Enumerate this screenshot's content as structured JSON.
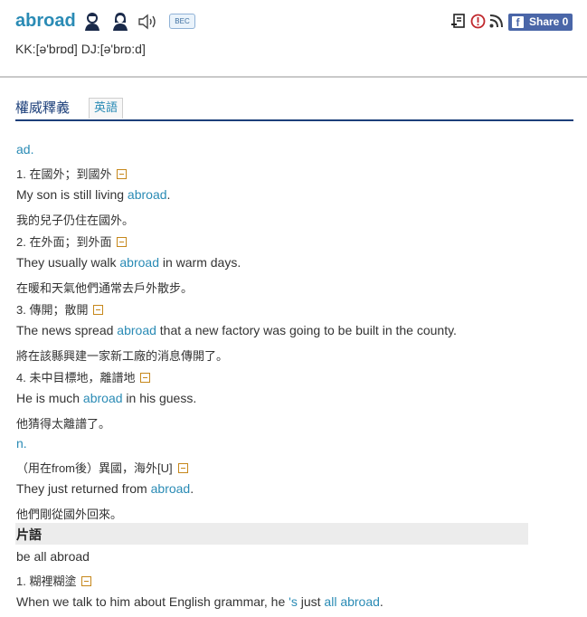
{
  "header": {
    "word": "abroad",
    "pronunciation": "KK:[ə'brɒd] DJ:[ə'brɒ:d]",
    "badge": "BEC",
    "share_label": "Share 0",
    "facebook_letter": "f"
  },
  "tabs": {
    "main": "權威釋義",
    "english": "英語"
  },
  "entries": {
    "l0": "ad.",
    "l1": "1. 在國外；到國外",
    "l2a": "My son is still living ",
    "l2b": "abroad",
    "l2c": ".",
    "l3": "我的兒子仍住在國外。",
    "l4": "2. 在外面；到外面",
    "l5a": "They usually walk ",
    "l5b": "abroad",
    "l5c": " in warm days.",
    "l6": "在暖和天氣他們通常去戶外散步。",
    "l7": "3. 傳開；散開",
    "l8a": "The news spread ",
    "l8b": "abroad",
    "l8c": " that a new factory was going to be built in the county.",
    "l9": "將在該縣興建一家新工廠的消息傳開了。",
    "l10": "4. 未中目標地，離譜地",
    "l11a": "He is much ",
    "l11b": "abroad",
    "l11c": " in his guess.",
    "l12": "他猜得太離譜了。",
    "l13": "n.",
    "l14": "（用在from後）異國，海外[U]",
    "l15a": "They just returned from ",
    "l15b": "abroad",
    "l15c": ".",
    "l16": "他們剛從國外回來。",
    "phrase_title": "片語",
    "l17": "be all abroad",
    "l18": "1. 糊裡糊塗",
    "l19a": "When we talk to him about English grammar, he ",
    "l19b": "'s",
    "l19c": " just ",
    "l19d": "all abroad",
    "l19e": "."
  },
  "colors": {
    "accent": "#2a8bb5",
    "tab_rule": "#1c3f7a",
    "share_bg": "#4a66a8",
    "toggle": "#c6871a"
  },
  "icons": [
    "male-voice-icon",
    "female-voice-icon",
    "speaker-icon",
    "word-list-icon",
    "report-icon",
    "rss-icon",
    "facebook-icon",
    "collapse-icon"
  ]
}
